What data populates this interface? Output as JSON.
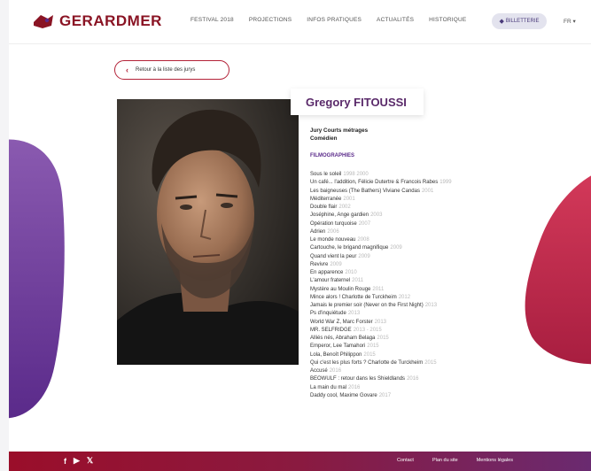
{
  "header": {
    "logo_text": "GERARDMER",
    "nav": [
      "FESTIVAL 2018",
      "PROJECTIONS",
      "INFOS PRATIQUES",
      "ACTUALITÉS",
      "HISTORIQUE"
    ],
    "ticket_label": "BILLETTERIE",
    "lang_label": "FR"
  },
  "back": {
    "label": "Retour à la liste des jurys"
  },
  "person": {
    "name": "Gregory FITOUSSI",
    "jury": "Jury Courts métrages",
    "role": "Comédien"
  },
  "filmography": {
    "title": "FILMOGRAPHIES",
    "items": [
      {
        "title": "Sous le soleil",
        "year": "1998 2000"
      },
      {
        "title": "Un café... l'addition, Félicie Dutertre & Francois Rabes",
        "year": "1999"
      },
      {
        "title": "Les baigneuses (The Bathers) Viviane Candas",
        "year": "2001"
      },
      {
        "title": "Méditerranée",
        "year": "2001"
      },
      {
        "title": "Double flair",
        "year": "2002"
      },
      {
        "title": "Joséphine, Ange gardien",
        "year": "2003"
      },
      {
        "title": "Opération turquoise",
        "year": "2007"
      },
      {
        "title": "Adrien",
        "year": "2006"
      },
      {
        "title": "Le monde nouveau",
        "year": "2008"
      },
      {
        "title": "Cartouche, le brigand magnifique",
        "year": "2009"
      },
      {
        "title": "Quand vient la peur",
        "year": "2009"
      },
      {
        "title": "Revivre",
        "year": "2009"
      },
      {
        "title": "En apparence",
        "year": "2010"
      },
      {
        "title": "L'amour fraternel",
        "year": "2011"
      },
      {
        "title": "Mystère au Moulin Rouge",
        "year": "2011"
      },
      {
        "title": "Mince alors ! Charlotte de Turckheim",
        "year": "2012"
      },
      {
        "title": "Jamais le premier soir (Never on the First Night)",
        "year": "2013"
      },
      {
        "title": "Ps d'inquiétude",
        "year": "2013"
      },
      {
        "title": "World War Z, Marc Forster",
        "year": "2013"
      },
      {
        "title": "MR. SELFRIDGE",
        "year": "2013 - 2015"
      },
      {
        "title": "Alliés nés, Abraham Belaga",
        "year": "2015"
      },
      {
        "title": "Emperor, Lee Tamahori",
        "year": "2015"
      },
      {
        "title": "Lola, Benoît Philippon",
        "year": "2015"
      },
      {
        "title": "Qui c'est les plus forts ? Charlotte de Turckheim",
        "year": "2015"
      },
      {
        "title": "Accusé",
        "year": "2016"
      },
      {
        "title": "BEOWULF : retour dans les Shieldlands",
        "year": "2016"
      },
      {
        "title": "La main du mal",
        "year": "2016"
      },
      {
        "title": "Daddy cool, Maxime Govare",
        "year": "2017"
      }
    ]
  },
  "footer": {
    "links": [
      "Contact",
      "Plan du site",
      "Mentions légales"
    ]
  },
  "colors": {
    "brand": "#8a1424",
    "accent": "#5a2a8a",
    "footer_start": "#9a0e2a",
    "footer_end": "#6a2a70"
  },
  "icons": [
    "facebook-icon",
    "youtube-icon",
    "twitter-icon",
    "ticket-icon",
    "chevron-left-icon"
  ]
}
